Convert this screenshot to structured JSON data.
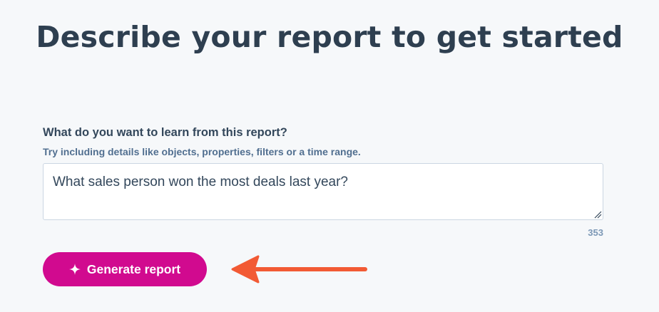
{
  "header": {
    "title": "Describe your report to get started"
  },
  "prompt": {
    "label": "What do you want to learn from this report?",
    "helper": "Try including details like objects, properties, filters or a time range.",
    "value": "What sales person won the most deals last year?",
    "char_count": "353"
  },
  "actions": {
    "generate_label": "Generate report",
    "generate_icon": "sparkle-icon",
    "accent_color": "#d10a8f"
  },
  "annotation": {
    "arrow_icon": "arrow-left-icon",
    "arrow_color": "#f25a34"
  }
}
